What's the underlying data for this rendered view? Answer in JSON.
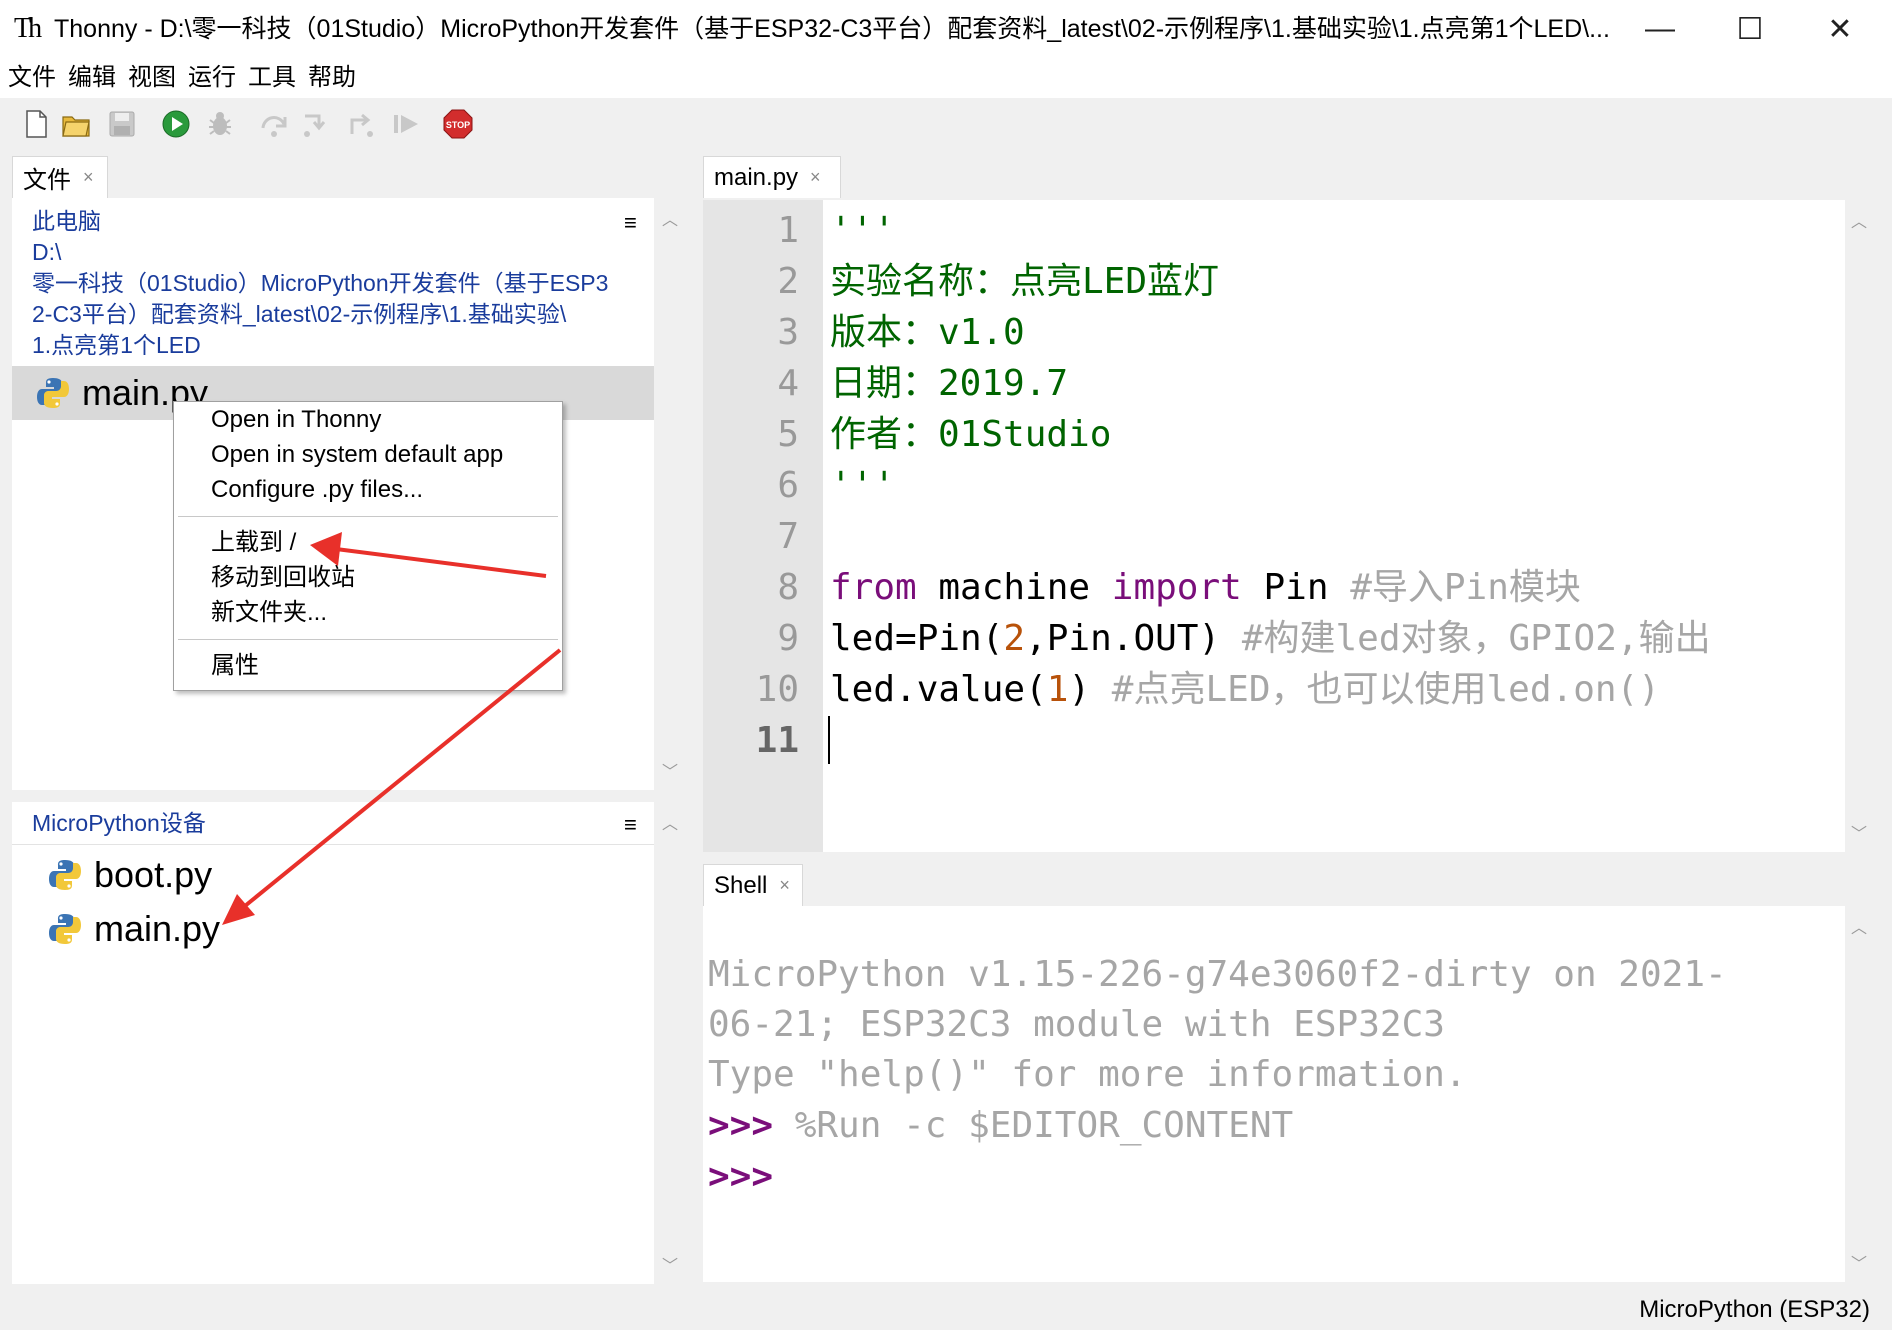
{
  "window": {
    "app_logo": "Th",
    "title": "Thonny  -  D:\\零一科技（01Studio）MicroPython开发套件（基于ESP32-C3平台）配套资料_latest\\02-示例程序\\1.基础实验\\1.点亮第1个LED\\...",
    "controls": {
      "minimize": "—",
      "maximize": "☐",
      "close": "✕"
    }
  },
  "menubar": [
    "文件",
    "编辑",
    "视图",
    "运行",
    "工具",
    "帮助"
  ],
  "toolbar": {
    "icons": [
      "new-file-icon",
      "open-folder-icon",
      "save-icon",
      "run-icon",
      "debug-icon",
      "step-over-icon",
      "step-into-icon",
      "step-out-icon",
      "resume-icon",
      "stop-icon"
    ],
    "stop_label": "STOP"
  },
  "files_pane": {
    "tab_label": "文件",
    "tab_close": "×",
    "menu_glyph": "≡",
    "computer": {
      "path_lines": [
        "此电脑",
        "D:\\",
        "零一科技（01Studio）MicroPython开发套件（基于ESP3",
        "2-C3平台）配套资料_latest\\02-示例程序\\1.基础实验\\",
        "1.点亮第1个LED"
      ],
      "files": [
        {
          "name": "main.py",
          "selected": true
        }
      ]
    },
    "device": {
      "title": "MicroPython设备",
      "files": [
        {
          "name": "boot.py"
        },
        {
          "name": "main.py"
        }
      ]
    }
  },
  "context_menu": {
    "items": [
      "Open in Thonny",
      "Open in system default app",
      "Configure .py files...",
      "上载到 /",
      "移动到回收站",
      "新文件夹...",
      "属性"
    ]
  },
  "editor": {
    "tab_label": "main.py",
    "tab_close": "×",
    "line_numbers": [
      "1",
      "2",
      "3",
      "4",
      "5",
      "6",
      "7",
      "8",
      "9",
      "10",
      "11"
    ],
    "lines": {
      "l1": "'''",
      "l2": "实验名称：点亮LED蓝灯",
      "l3": "版本：v1.0",
      "l4": "日期：2019.7",
      "l5": "作者：01Studio",
      "l6": "'''",
      "l8": {
        "kw1": "from",
        "mod": " machine ",
        "kw2": "import",
        "name": " Pin ",
        "cmt": "#导入Pin模块"
      },
      "l9": {
        "a": "led=Pin(",
        "num": "2",
        "b": ",Pin.OUT) ",
        "cmt": "#构建led对象，GPIO2,输出"
      },
      "l10": {
        "a": "led.value(",
        "num": "1",
        "b": ") ",
        "cmt": "#点亮LED，也可以使用led.on()"
      }
    }
  },
  "shell": {
    "tab_label": "Shell",
    "tab_close": "×",
    "banner": [
      "MicroPython v1.15-226-g74e3060f2-dirty on 2021-",
      "06-21; ESP32C3 module with ESP32C3",
      "Type \"help()\" for more information."
    ],
    "prompt": ">>>",
    "command": " %Run -c $EDITOR_CONTENT"
  },
  "statusbar": {
    "interpreter": "MicroPython (ESP32)"
  },
  "colors": {
    "arrow": "#e8302a",
    "path_link": "#1a3c9c",
    "keyword": "#7a0e7a",
    "string": "#006400",
    "comment": "#a6a6a6",
    "number": "#b8520a"
  }
}
